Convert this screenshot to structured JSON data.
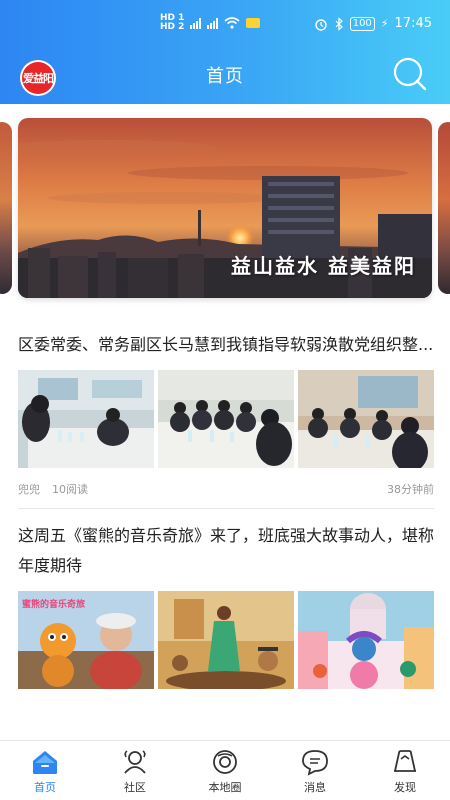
{
  "status_bar": {
    "network_top": "HD 1",
    "network_bottom": "HD 2",
    "battery": "100",
    "time": "17:45"
  },
  "header": {
    "logo_text": "爱益阳",
    "title": "首页"
  },
  "banner": {
    "caption": "益山益水  益美益阳"
  },
  "articles": [
    {
      "title": "区委常委、常务副区长马慧到我镇指导软弱涣散党组织整...",
      "author": "兜兜",
      "reads": "10阅读",
      "time": "38分钟前"
    },
    {
      "title": "这周五《蜜熊的音乐奇旅》来了，班底强大故事动人，堪称年度期待",
      "poster_text": "蜜熊的音乐奇旅"
    }
  ],
  "tabs": [
    {
      "label": "首页",
      "icon": "home-icon",
      "active": true
    },
    {
      "label": "社区",
      "icon": "community-icon",
      "active": false
    },
    {
      "label": "本地圈",
      "icon": "local-circle-icon",
      "active": false
    },
    {
      "label": "消息",
      "icon": "message-icon",
      "active": false
    },
    {
      "label": "发现",
      "icon": "discover-icon",
      "active": false
    }
  ],
  "colors": {
    "brand_blue": "#2d86f3",
    "logo_red": "#e8262a"
  }
}
